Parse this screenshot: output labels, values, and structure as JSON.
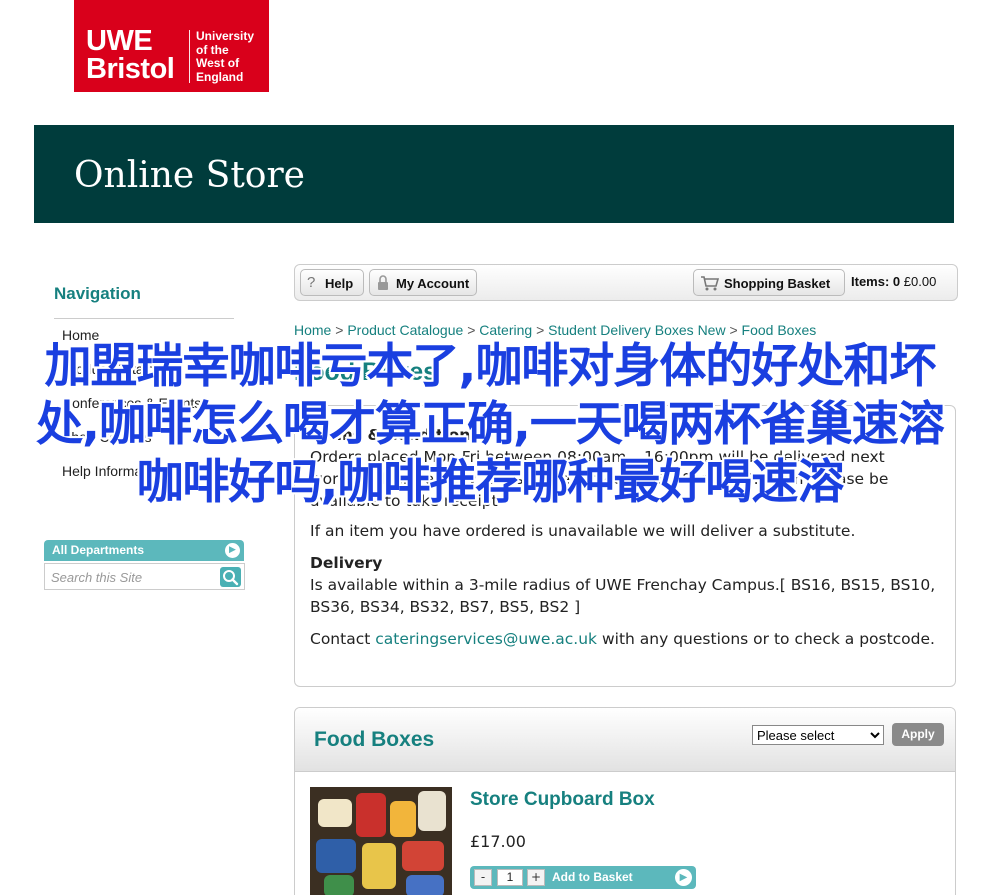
{
  "logo": {
    "brand_line1": "UWE",
    "brand_line2": "Bristol",
    "uni_line1": "University",
    "uni_line2": "of the",
    "uni_line3": "West of",
    "uni_line4": "England",
    "color": "#d9001b"
  },
  "banner": {
    "title": "Online Store",
    "color": "#003c3c"
  },
  "sidebar": {
    "title": "Navigation",
    "items": [
      {
        "label": "Home"
      },
      {
        "label": "Product Catalogue"
      },
      {
        "label": "Conferences & Events"
      },
      {
        "label": "Short Courses"
      },
      {
        "label": "Help Information"
      }
    ],
    "departments_label": "All Departments",
    "search_placeholder": "Search this Site"
  },
  "toolbar": {
    "help_label": "Help",
    "account_label": "My Account",
    "basket_label": "Shopping Basket",
    "items_label": "Items:",
    "items_count": "0",
    "items_total": "£0.00"
  },
  "breadcrumb": {
    "items": [
      "Home",
      "Product Catalogue",
      "Catering",
      "Student Delivery Boxes New",
      "Food Boxes"
    ],
    "separator": ">"
  },
  "page_title": "Food Boxes",
  "info": {
    "terms_title": "Terms & Conditions",
    "terms_text": "Orders placed Mon-Fri between 08:00am – 16:00pm will be delivered next working day. Delivery takes place between 08:00am – 16:00pm, please be available to take receipt",
    "substitute_text": "If an item you have ordered is unavailable we will deliver a substitute.",
    "delivery_title": "Delivery",
    "delivery_text": "Is available within a 3-mile radius of UWE Frenchay Campus.[ BS16, BS15, BS10, BS36, BS34, BS32, BS7, BS5, BS2 ]",
    "contact_prefix": "Contact",
    "contact_email": "cateringservices@uwe.ac.uk",
    "contact_suffix": "with any questions or to check a postcode."
  },
  "listing": {
    "title": "Food Boxes",
    "sort_selected": "Please select",
    "apply_label": "Apply",
    "products": [
      {
        "name": "Store Cupboard Box",
        "price": "£17.00",
        "qty": "1",
        "minus": "-",
        "plus": "+",
        "add_label": "Add to Basket"
      }
    ]
  },
  "overlay_text": "加盟瑞幸咖啡亏本了,咖啡对身体的好处和坏处,咖啡怎么喝才算正确,一天喝两杯雀巢速溶咖啡好吗,咖啡推荐哪种最好喝速溶",
  "colors": {
    "accent": "#16807f",
    "teal_button": "#5cb8bc",
    "overlay": "#1a3fe0"
  }
}
